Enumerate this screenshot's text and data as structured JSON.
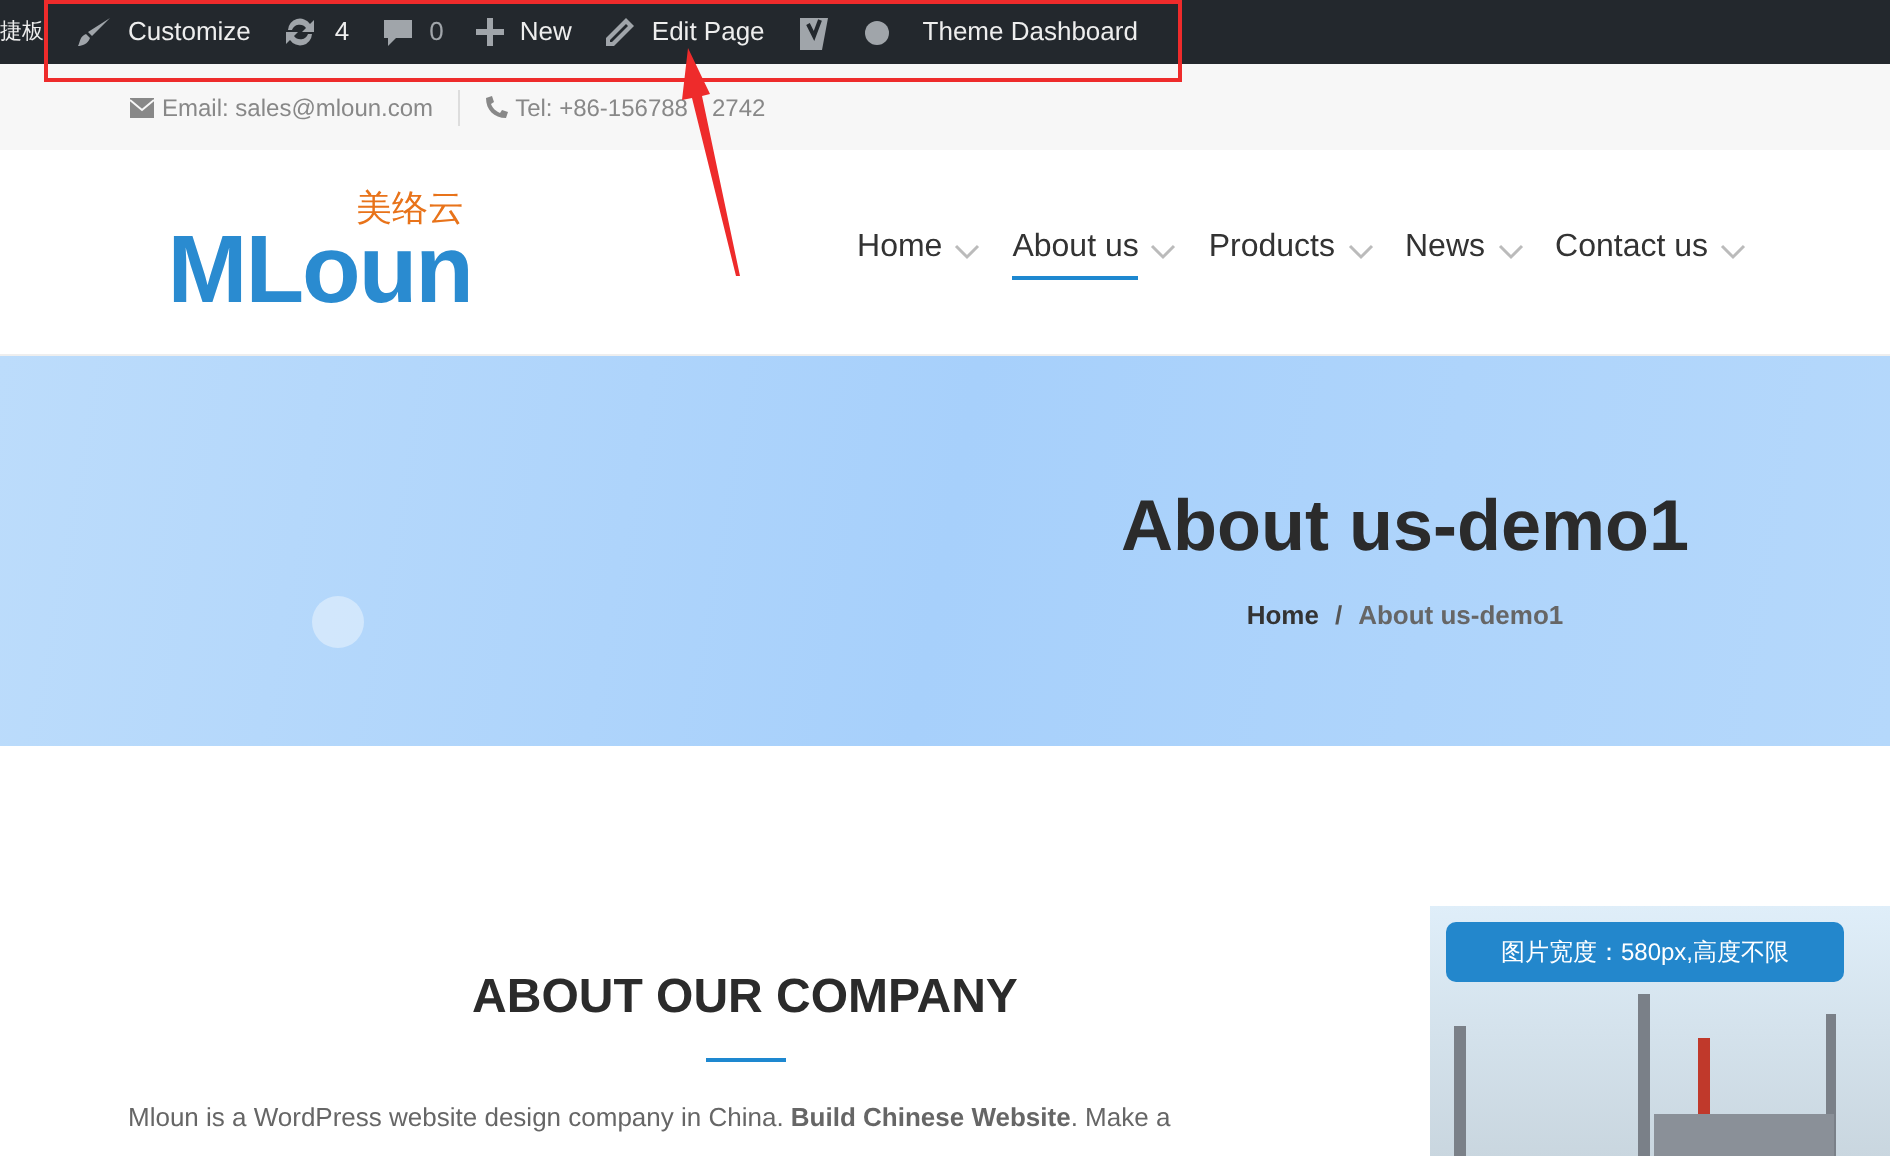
{
  "admin_bar": {
    "cut_label": "捷板",
    "items": [
      {
        "kind": "brush",
        "label": "Customize"
      },
      {
        "kind": "updates",
        "label": "4"
      },
      {
        "kind": "comments",
        "label": "0"
      },
      {
        "kind": "plus",
        "label": "New"
      },
      {
        "kind": "pencil",
        "label": "Edit Page"
      },
      {
        "kind": "yoast"
      },
      {
        "kind": "dot"
      },
      {
        "kind": "text",
        "label": "Theme Dashboard"
      }
    ]
  },
  "top_bar": {
    "email": "Email: sales@mloun.com",
    "tel": [
      "Tel: +86-156788",
      "2742"
    ]
  },
  "logo": {
    "text": "MLoun",
    "tagline": "美络云"
  },
  "nav": [
    {
      "label": "Home",
      "selected": false
    },
    {
      "label": "About us",
      "selected": true
    },
    {
      "label": "Products",
      "selected": false
    },
    {
      "label": "News",
      "selected": false
    },
    {
      "label": "Contact us",
      "selected": false
    }
  ],
  "hero": {
    "title": "About us-demo1",
    "breadcrumb": [
      "Home",
      "About us-demo1"
    ],
    "separator": "/"
  },
  "about": {
    "heading": "ABOUT OUR COMPANY",
    "text": "Mloun is a WordPress website design company in China. **Build Chinese Website**. Make a"
  },
  "side_image": {
    "caption": "图片宽度：580px,高度不限"
  }
}
